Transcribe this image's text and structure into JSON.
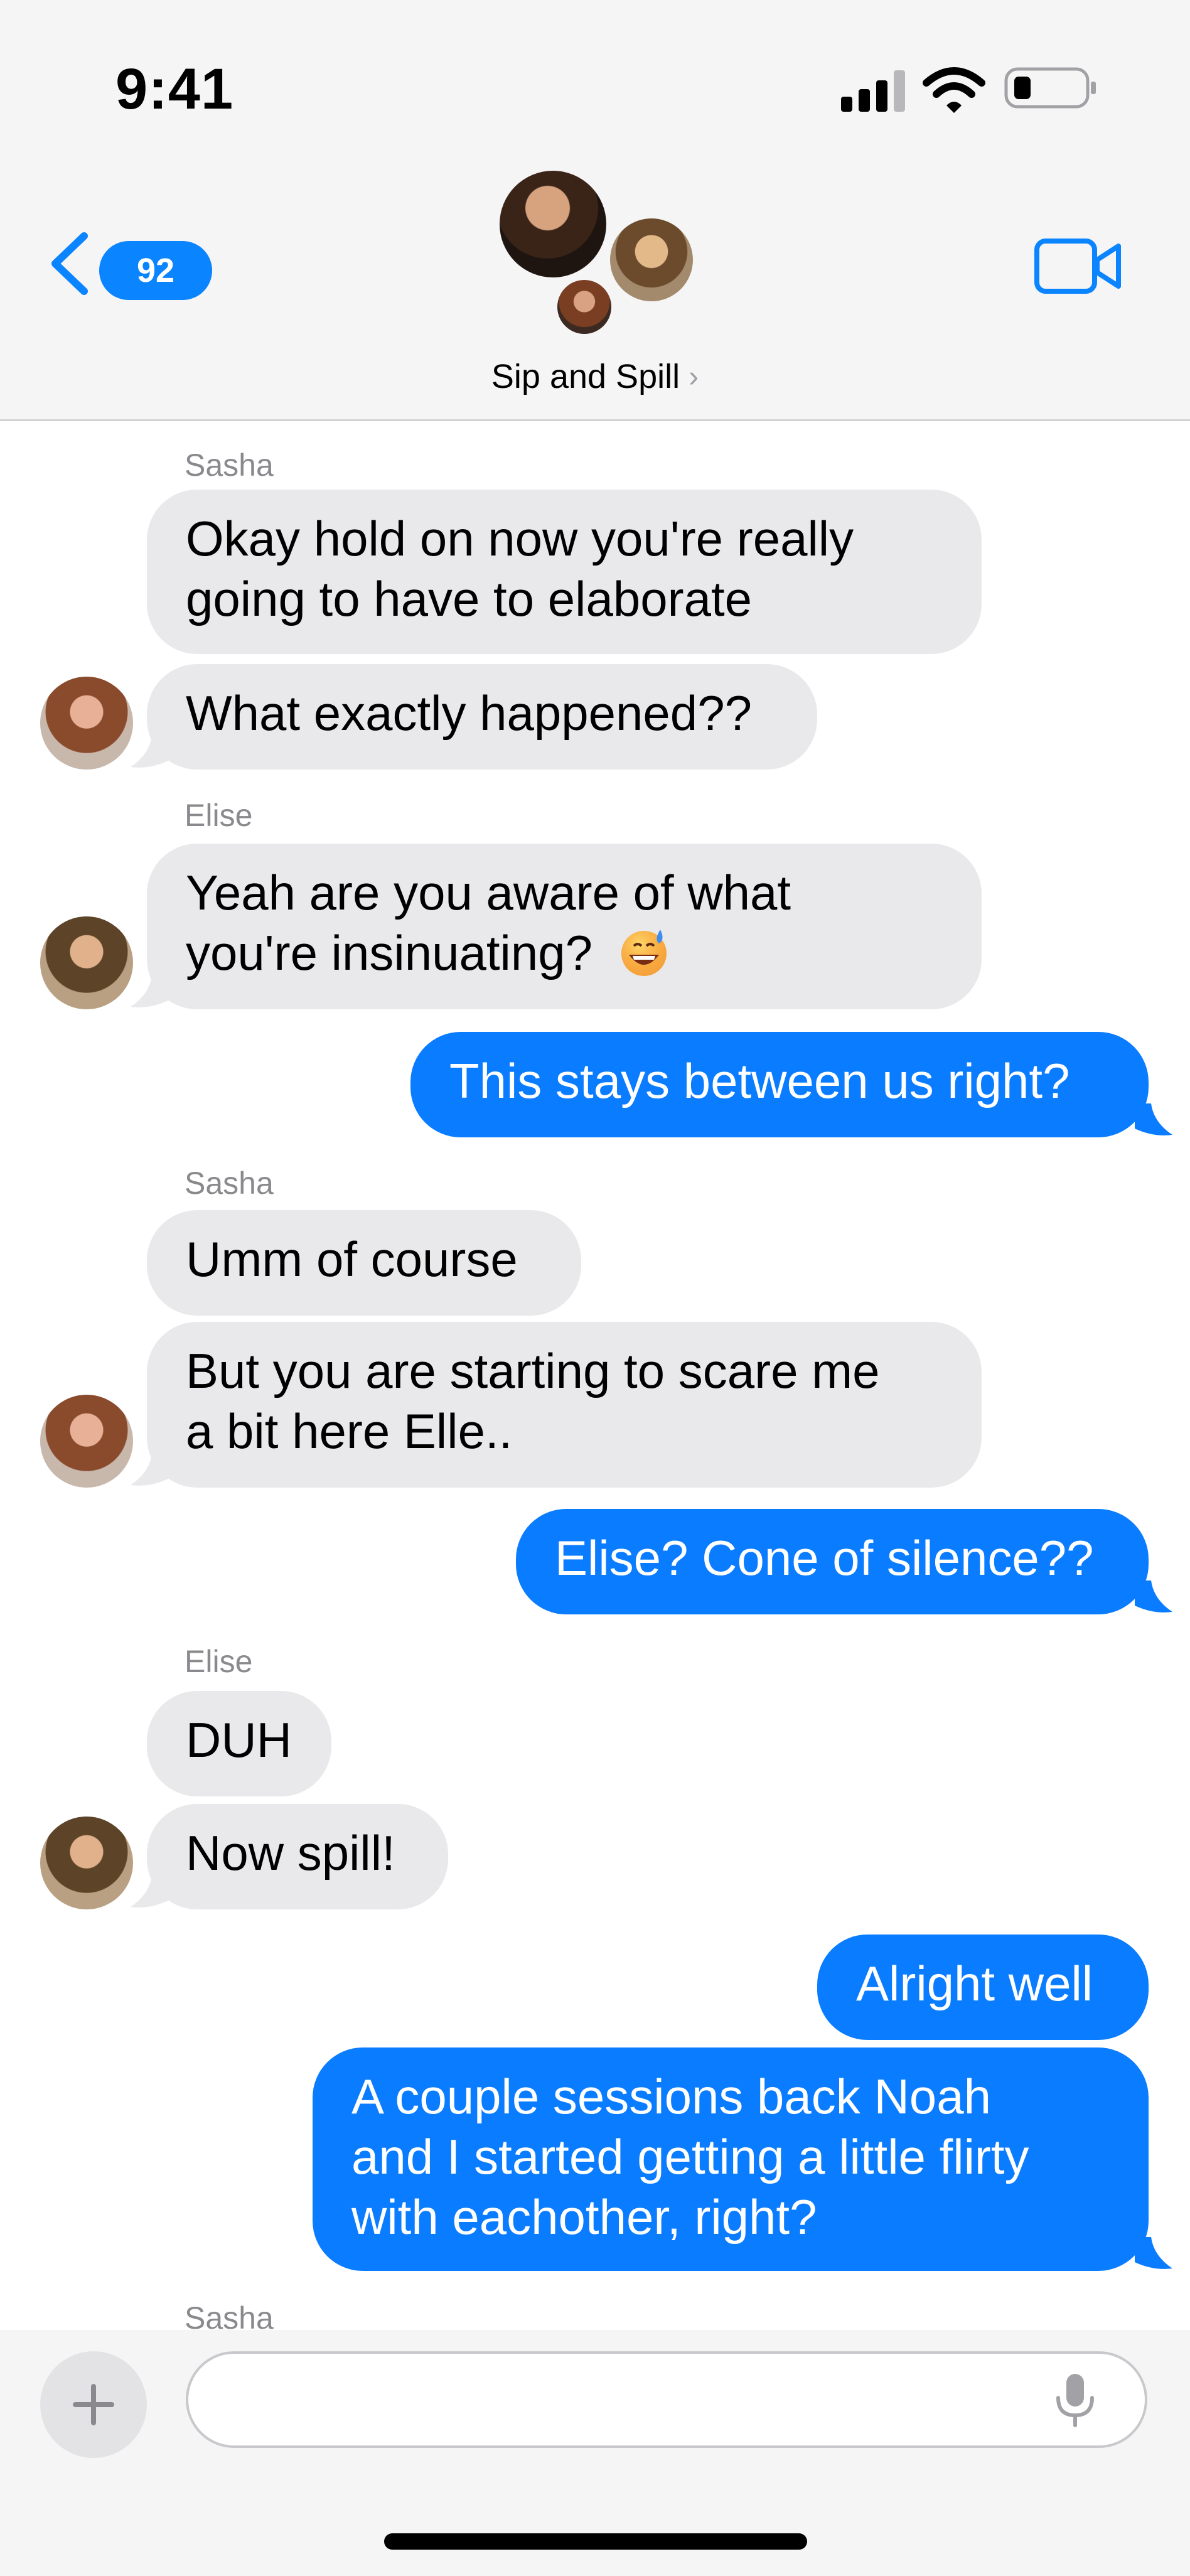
{
  "status_bar": {
    "time": "9:41"
  },
  "header": {
    "back_badge_count": "92",
    "group_name": "Sip and Spill",
    "group_chevron": "›"
  },
  "messages": [
    {
      "sender": "Sasha",
      "text": "Okay hold on now you're really\ngoing to have to elaborate",
      "direction": "incoming"
    },
    {
      "text": "What exactly happened??",
      "direction": "incoming"
    },
    {
      "sender": "Elise",
      "text": "Yeah are you aware of what\nyou're insinuating?",
      "direction": "incoming",
      "emoji": "grinning-sweat-emoji"
    },
    {
      "text": "This stays between us right?",
      "direction": "outgoing"
    },
    {
      "sender": "Sasha",
      "text": "Umm of course",
      "direction": "incoming"
    },
    {
      "text": "But you are starting to scare me\na bit here Elle..",
      "direction": "incoming"
    },
    {
      "text": "Elise? Cone of silence??",
      "direction": "outgoing"
    },
    {
      "sender": "Elise",
      "text": "DUH",
      "direction": "incoming"
    },
    {
      "text": "Now spill!",
      "direction": "incoming"
    },
    {
      "text": "Alright well",
      "direction": "outgoing"
    },
    {
      "text": "A couple sessions back Noah\nand I started getting a little flirty\nwith eachother, right?",
      "direction": "outgoing"
    },
    {
      "sender": "Sasha",
      "direction": "incoming"
    }
  ],
  "composer": {
    "plus_label": "+"
  },
  "colors": {
    "outgoing": "#0a7cff",
    "incoming": "#e9e9eb",
    "accent": "#0a84ff"
  },
  "icons": [
    "back-chevron-icon",
    "video-call-icon",
    "signal-icon",
    "wifi-icon",
    "battery-icon",
    "plus-icon",
    "microphone-icon"
  ]
}
